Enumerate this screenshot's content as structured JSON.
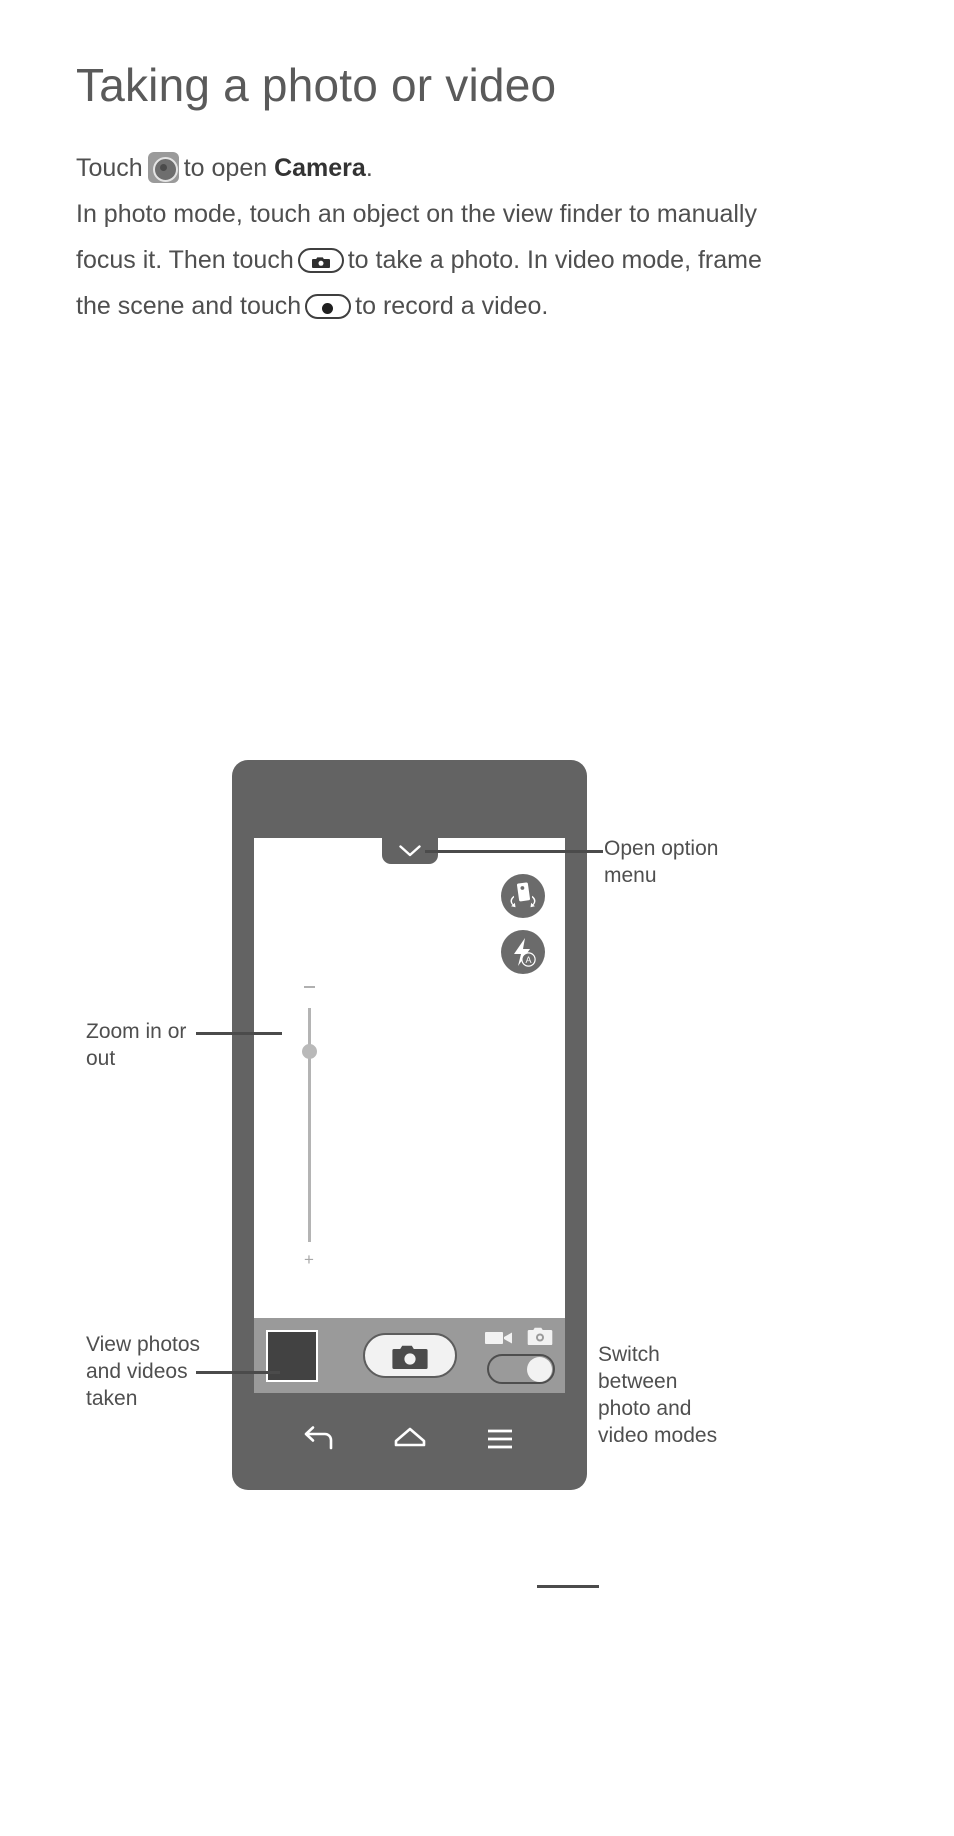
{
  "page": {
    "title": "Taking a photo or video"
  },
  "body": {
    "line1_pre": "Touch",
    "icon_camera_app": "camera-app-icon",
    "line1_mid": "to open",
    "line1_bold": "Camera",
    "line1_end": ".",
    "line2": "In photo mode, touch an object on the view finder to manually focus it. Then touch",
    "icon_shutter": "shutter-button-icon",
    "line3": "to take a photo. In video mode, frame the scene and touch",
    "icon_record": "record-button-icon",
    "line4": "to record a video."
  },
  "phone": {
    "screen": {
      "option_tab": {
        "icon": "chevron-down-icon"
      },
      "icons": [
        {
          "name": "switch-camera-icon"
        },
        {
          "name": "flash-auto-icon",
          "badge": "A"
        }
      ],
      "zoom_slider": {
        "minus_label": "−",
        "plus_label": "+",
        "handle_position_percent": 25
      },
      "toolbar": {
        "thumbnail": "gallery-thumbnail",
        "shutter": "shutter-button",
        "video_icon": "video-camera-icon",
        "photo_icon": "photo-camera-icon",
        "mode_toggle_position": "photo"
      }
    },
    "navbar": {
      "back": "back-icon",
      "home": "home-icon",
      "menu": "menu-icon"
    }
  },
  "callouts": {
    "open_option_menu": "Open option\nmenu",
    "zoom": "Zoom in or\nout",
    "view_photos": "View photos\nand videos\ntaken",
    "switch_modes": "Switch\nbetween\nphoto and\nvideo modes"
  },
  "colors": {
    "phone_body": "#636363",
    "screen": "#ffffff",
    "toolbar": "#9a9a9a",
    "text": "#4f4f4f",
    "title": "#5a5a5a",
    "thumbnail": "#424242",
    "slider_track": "#b4b4b4"
  }
}
